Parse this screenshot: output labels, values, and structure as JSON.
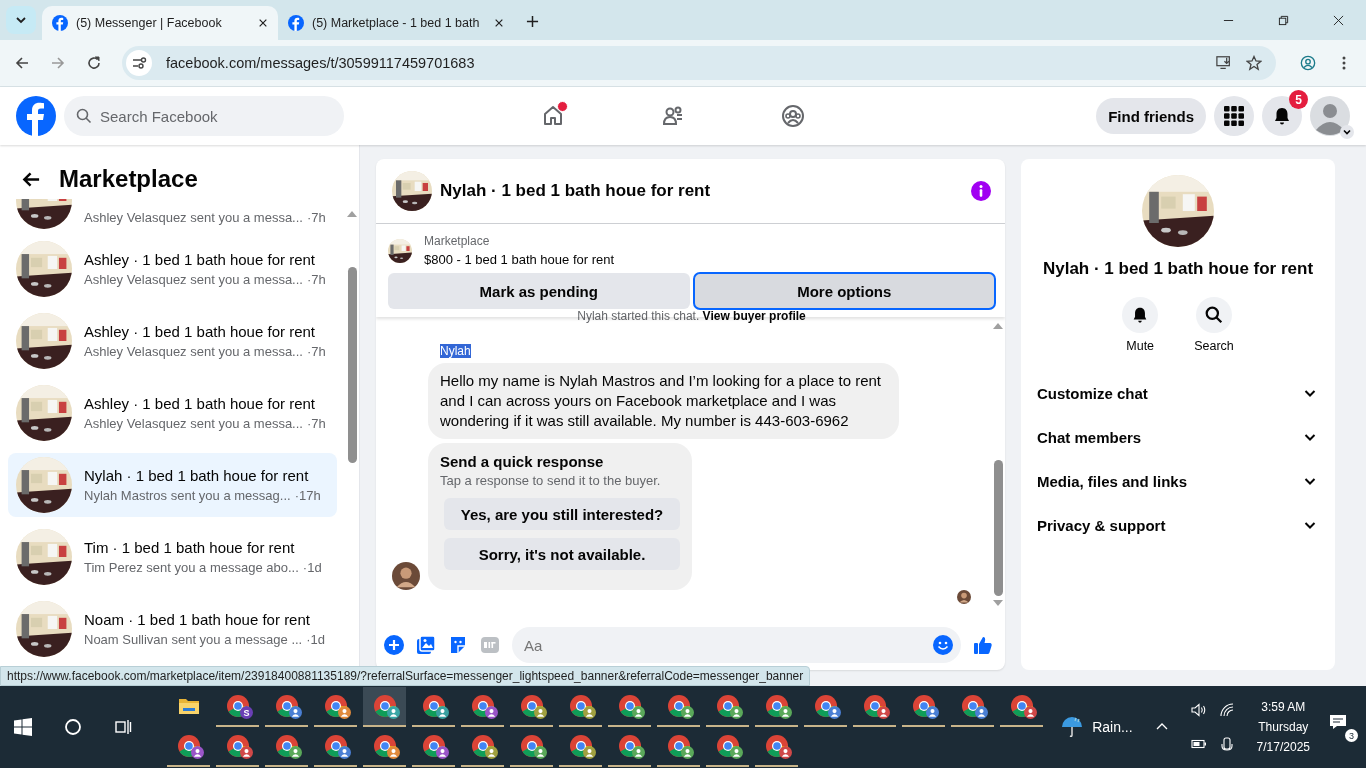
{
  "browser": {
    "tabs": [
      {
        "title": "(5) Messenger | Facebook",
        "selected": true
      },
      {
        "title": "(5) Marketplace - 1 bed 1 bath",
        "selected": false
      }
    ],
    "url": "facebook.com/messages/t/30599117459701683"
  },
  "fb_header": {
    "search": {
      "placeholder": "Search Facebook"
    },
    "nav": [
      {
        "kind": "home",
        "dot": true
      },
      {
        "kind": "friends",
        "dot": false
      },
      {
        "kind": "groups",
        "dot": false
      }
    ],
    "find_friends": "Find friends",
    "notifications_badge": "5"
  },
  "sidebar": {
    "title": "Marketplace",
    "conversations": [
      {
        "preview": "Ashley Velasquez sent you a messa...",
        "time": "·7h",
        "selected": false,
        "cut": true
      },
      {
        "title": "Ashley · 1 bed 1 bath houe for rent",
        "preview": "Ashley Velasquez sent you a messa...",
        "time": "·7h",
        "selected": false,
        "cut": false
      },
      {
        "title": "Ashley · 1 bed 1 bath houe for rent",
        "preview": "Ashley Velasquez sent you a messa...",
        "time": "·7h",
        "selected": false,
        "cut": false
      },
      {
        "title": "Ashley · 1 bed 1 bath houe for rent",
        "preview": "Ashley Velasquez sent you a messa...",
        "time": "·7h",
        "selected": false,
        "cut": false
      },
      {
        "title": "Nylah · 1 bed 1 bath houe for rent",
        "preview": "Nylah Mastros sent you a messag...",
        "time": "·17h",
        "selected": true,
        "cut": false
      },
      {
        "title": "Tim · 1 bed 1 bath houe for rent",
        "preview": "Tim Perez sent you a message abo...",
        "time": "·1d",
        "selected": false,
        "cut": false
      },
      {
        "title": "Noam · 1 bed 1 bath houe for rent",
        "preview": "Noam Sullivan sent you a message ...",
        "time": "·1d",
        "selected": false,
        "cut": false
      }
    ]
  },
  "chat": {
    "title": "Nylah · 1 bed 1 bath houe for rent",
    "listing": {
      "label": "Marketplace",
      "price_title": "$800 - 1 bed 1 bath houe for rent"
    },
    "actions": [
      {
        "label": "Mark as pending",
        "focused": false
      },
      {
        "label": "More options",
        "focused": true
      }
    ],
    "system_note": {
      "text": "Nylah started this chat.",
      "link": "View buyer profile"
    },
    "sender": {
      "name": "Nylah",
      "highlighted": true
    },
    "message": "Hello my name is Nylah Mastros and I’m looking for a place to rent and I can across yours on Facebook marketplace and I was wondering if it was still available. My number is 443-603-6962",
    "quick_response": {
      "title": "Send a quick response",
      "hint": "Tap a response to send it to the buyer.",
      "options": [
        "Yes, are you still interested?",
        "Sorry, it's not available."
      ]
    },
    "composer": {
      "placeholder": "Aa"
    }
  },
  "details": {
    "name": "Nylah · 1 bed 1 bath houe for rent",
    "actions": [
      {
        "kind": "mute",
        "label": "Mute"
      },
      {
        "kind": "search",
        "label": "Search"
      }
    ],
    "sections": [
      {
        "label": "Customize chat",
        "expanded": false
      },
      {
        "label": "Chat members",
        "expanded": false
      },
      {
        "label": "Media, files and links",
        "expanded": false
      },
      {
        "label": "Privacy & support",
        "expanded": false
      }
    ]
  },
  "status_url": "https://www.facebook.com/marketplace/item/23918400881135189/?referralSurface=messenger_lightspeed_banner&referralCode=messenger_banner",
  "taskbar": {
    "apps": [
      {
        "kind": "folder",
        "selected": false
      },
      {
        "kind": "browser",
        "color": "#6a3fb5",
        "badge": "S",
        "selected": false
      },
      {
        "kind": "browser",
        "color": "#4a7fd4",
        "selected": false
      },
      {
        "kind": "browser",
        "color": "#e08a3c",
        "selected": false
      },
      {
        "kind": "browser",
        "color": "#3aa6a6",
        "selected": true
      },
      {
        "kind": "browser",
        "color": "#39a0a0",
        "selected": false
      },
      {
        "kind": "browser",
        "color": "#9a55c8",
        "selected": false
      },
      {
        "kind": "browser",
        "color": "#a0a040",
        "selected": false
      },
      {
        "kind": "browser",
        "color": "#a0a040",
        "selected": false
      },
      {
        "kind": "browser",
        "color": "#5aa85a",
        "selected": false
      },
      {
        "kind": "browser",
        "color": "#5aa85a",
        "selected": false
      },
      {
        "kind": "browser",
        "color": "#5aa85a",
        "selected": false
      },
      {
        "kind": "browser",
        "color": "#5aa85a",
        "selected": false
      },
      {
        "kind": "browser",
        "color": "#4a7fd4",
        "selected": false
      },
      {
        "kind": "browser",
        "color": "#d04848",
        "selected": false
      },
      {
        "kind": "browser",
        "color": "#4a7fd4",
        "selected": false
      },
      {
        "kind": "browser",
        "color": "#4a7fd4",
        "selected": false
      },
      {
        "kind": "browser",
        "color": "#d04848",
        "selected": false
      },
      {
        "kind": "browser",
        "color": "#9a55c8",
        "selected": false
      },
      {
        "kind": "browser",
        "color": "#d04848",
        "selected": false
      },
      {
        "kind": "browser",
        "color": "#5aa85a",
        "selected": false
      },
      {
        "kind": "browser",
        "color": "#4a7fd4",
        "selected": false
      },
      {
        "kind": "browser",
        "color": "#e08a3c",
        "selected": false
      },
      {
        "kind": "browser",
        "color": "#9a55c8",
        "selected": false
      },
      {
        "kind": "browser",
        "color": "#a0a040",
        "selected": false
      },
      {
        "kind": "browser",
        "color": "#5aa85a",
        "selected": false
      },
      {
        "kind": "browser",
        "color": "#a0a040",
        "selected": false
      },
      {
        "kind": "browser",
        "color": "#5aa85a",
        "selected": false
      },
      {
        "kind": "browser",
        "color": "#5aa85a",
        "selected": false
      },
      {
        "kind": "browser",
        "color": "#5aa85a",
        "selected": false
      },
      {
        "kind": "browser",
        "color": "#d04848",
        "selected": false
      }
    ],
    "weather": "Rain...",
    "time": "3:59 AM",
    "day": "Thursday",
    "date": "7/17/2025",
    "notifications": "3"
  }
}
